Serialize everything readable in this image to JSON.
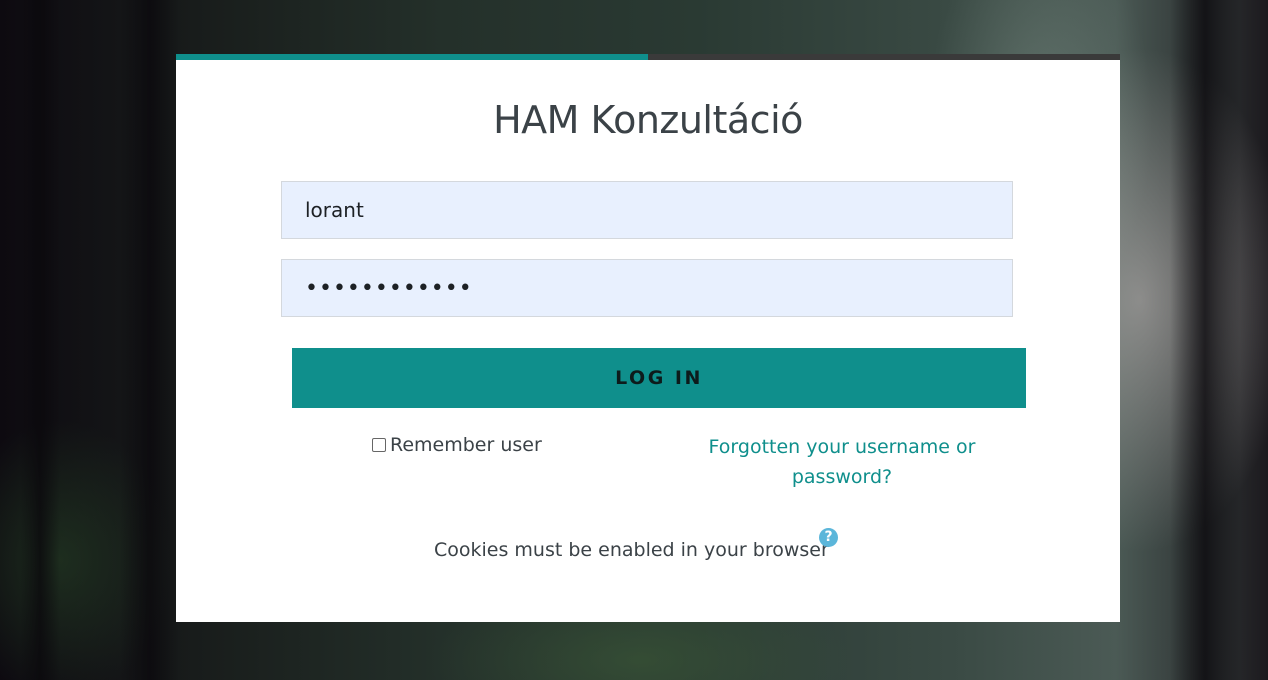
{
  "site": {
    "title": "HAM Konzultáció"
  },
  "login": {
    "progress_fraction": 0.5,
    "username_value": "lorant",
    "password_mask": "••••••••••••",
    "login_button_label": "LOG IN",
    "remember_label": "Remember user",
    "remember_checked": false,
    "forgot_link_label": "Forgotten your username or password?",
    "cookies_notice": "Cookies must be enabled in your browser",
    "help_icon": "question-circle-icon",
    "help_glyph": "?"
  },
  "colors": {
    "accent": "#0f8f8c",
    "input_background": "#e8f0fe",
    "help_icon": "#5bb6da",
    "text": "#3b4247"
  }
}
